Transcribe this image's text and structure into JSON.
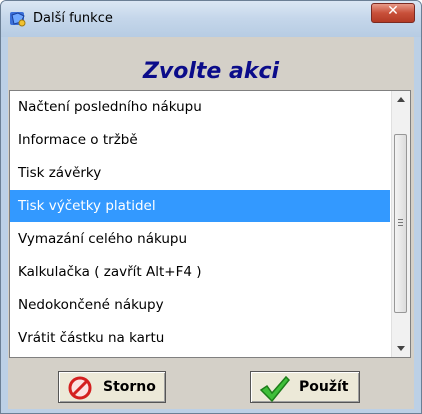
{
  "window": {
    "title": "Další funkce"
  },
  "dialog": {
    "heading": "Zvolte akci"
  },
  "list": {
    "items": [
      "Načtení posledního nákupu",
      "Informace o tržbě",
      "Tisk závěrky",
      "Tisk výčetky platidel",
      "Vymazání celého nákupu",
      "Kalkulačka ( zavřít Alt+F4 )",
      "Nedokončené nákupy",
      "Vrátit částku na kartu"
    ],
    "selected_index": 3
  },
  "buttons": {
    "cancel": "Storno",
    "apply": "Použít"
  },
  "colors": {
    "heading": "#0b0c8a",
    "selection": "#3399ff",
    "close": "#c8503a"
  }
}
